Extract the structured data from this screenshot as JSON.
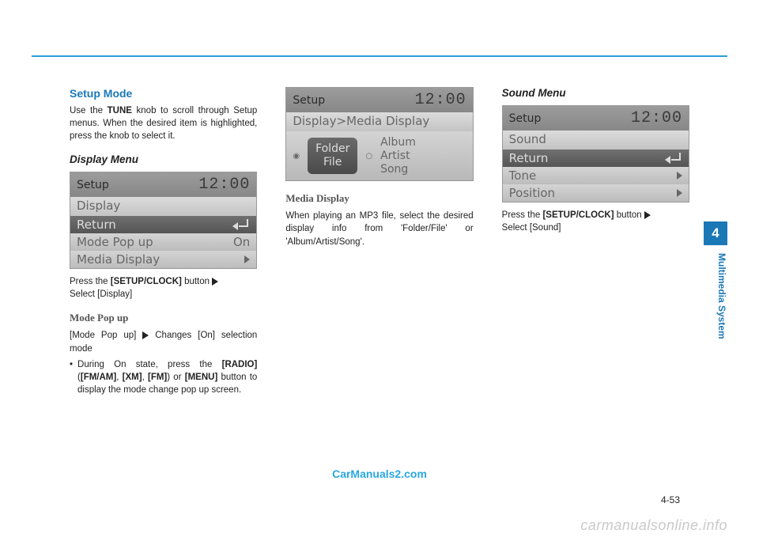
{
  "page": {
    "setup_mode_heading": "Setup Mode",
    "setup_mode_body_pre": "Use the ",
    "setup_mode_body_bold": "TUNE",
    "setup_mode_body_post": " knob to scroll through Setup menus. When the desired item is highlighted, press the knob to select it.",
    "display_menu_heading": "Display Menu",
    "display_instr_pre": "Press the ",
    "display_instr_bold": "[SETUP/CLOCK]",
    "display_instr_post": " button ",
    "display_instr_after": "Select [Display]",
    "mode_popup_heading": "Mode Pop up",
    "mode_popup_line": "[Mode Pop up] ",
    "mode_popup_line_after": " Changes [On] selection mode",
    "mode_popup_bullet_pre": "During On state, press the ",
    "mode_popup_bullet_b1": "[RADIO]",
    "mode_popup_bullet_mid1": " (",
    "mode_popup_bullet_b2": "[FM/AM]",
    "mode_popup_bullet_mid2": ", ",
    "mode_popup_bullet_b3": "[XM]",
    "mode_popup_bullet_mid3": ", ",
    "mode_popup_bullet_b4": "[FM]",
    "mode_popup_bullet_mid4": ") or ",
    "mode_popup_bullet_b5": "[MENU]",
    "mode_popup_bullet_post": " button to display the mode change pop up screen.",
    "media_display_heading": "Media Display",
    "media_display_body": "When playing an MP3 file, select the desired display info from 'Folder/File' or 'Album/Artist/Song'.",
    "sound_menu_heading": "Sound Menu",
    "sound_instr_pre": "Press the ",
    "sound_instr_bold": "[SETUP/CLOCK]",
    "sound_instr_post": " button ",
    "sound_instr_after": "Select [Sound]"
  },
  "screens": {
    "display": {
      "title": "Setup",
      "time": "12:00",
      "sub": "Display",
      "rows": [
        {
          "label": "Return",
          "icon": "return"
        },
        {
          "label": "Mode Pop up",
          "value": "On"
        },
        {
          "label": "Media Display",
          "icon": "triangle"
        }
      ]
    },
    "media": {
      "title": "Setup",
      "time": "12:00",
      "sub": "Display>Media Display",
      "opt_selected_line1": "Folder",
      "opt_selected_line2": "File",
      "opt_other_line1": "Album",
      "opt_other_line2": "Artist",
      "opt_other_line3": "Song"
    },
    "sound": {
      "title": "Setup",
      "time": "12:00",
      "sub": "Sound",
      "rows": [
        {
          "label": "Return",
          "icon": "return"
        },
        {
          "label": "Tone",
          "icon": "triangle"
        },
        {
          "label": "Position",
          "icon": "triangle"
        }
      ]
    }
  },
  "side": {
    "chapter": "4",
    "label": "Multimedia System"
  },
  "footer": {
    "watermark1": "CarManuals2.com",
    "pagenum": "4-53",
    "watermark2": "carmanualsonline.info"
  }
}
